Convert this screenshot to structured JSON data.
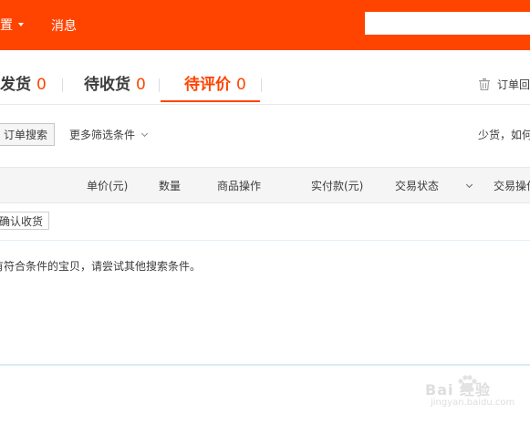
{
  "topbar": {
    "settings_label": "置",
    "messages_label": "消息",
    "search_value": ""
  },
  "tabs": [
    {
      "label": "发货",
      "count": "0",
      "active": false
    },
    {
      "label": "待收货",
      "count": "0",
      "active": false
    },
    {
      "label": "待评价",
      "count": "0",
      "active": true
    }
  ],
  "trash_label": "订单回",
  "toolbar": {
    "search_button": "订单搜索",
    "filter_label": "更多筛选条件",
    "notice_text": "少货，如何"
  },
  "table": {
    "headers": [
      "单价(元)",
      "数量",
      "商品操作",
      "实付款(元)",
      "交易状态",
      "交易操作"
    ]
  },
  "confirm_button": "确认收货",
  "empty_message": "有符合条件的宝贝，请尝试其他搜索条件。",
  "watermark": {
    "brand": "Bai 经验",
    "url": "jingyan.baidu.com"
  },
  "colors": {
    "accent": "#ff4400",
    "header_bg": "#f5f5f5",
    "divider": "#d9ebf5"
  }
}
